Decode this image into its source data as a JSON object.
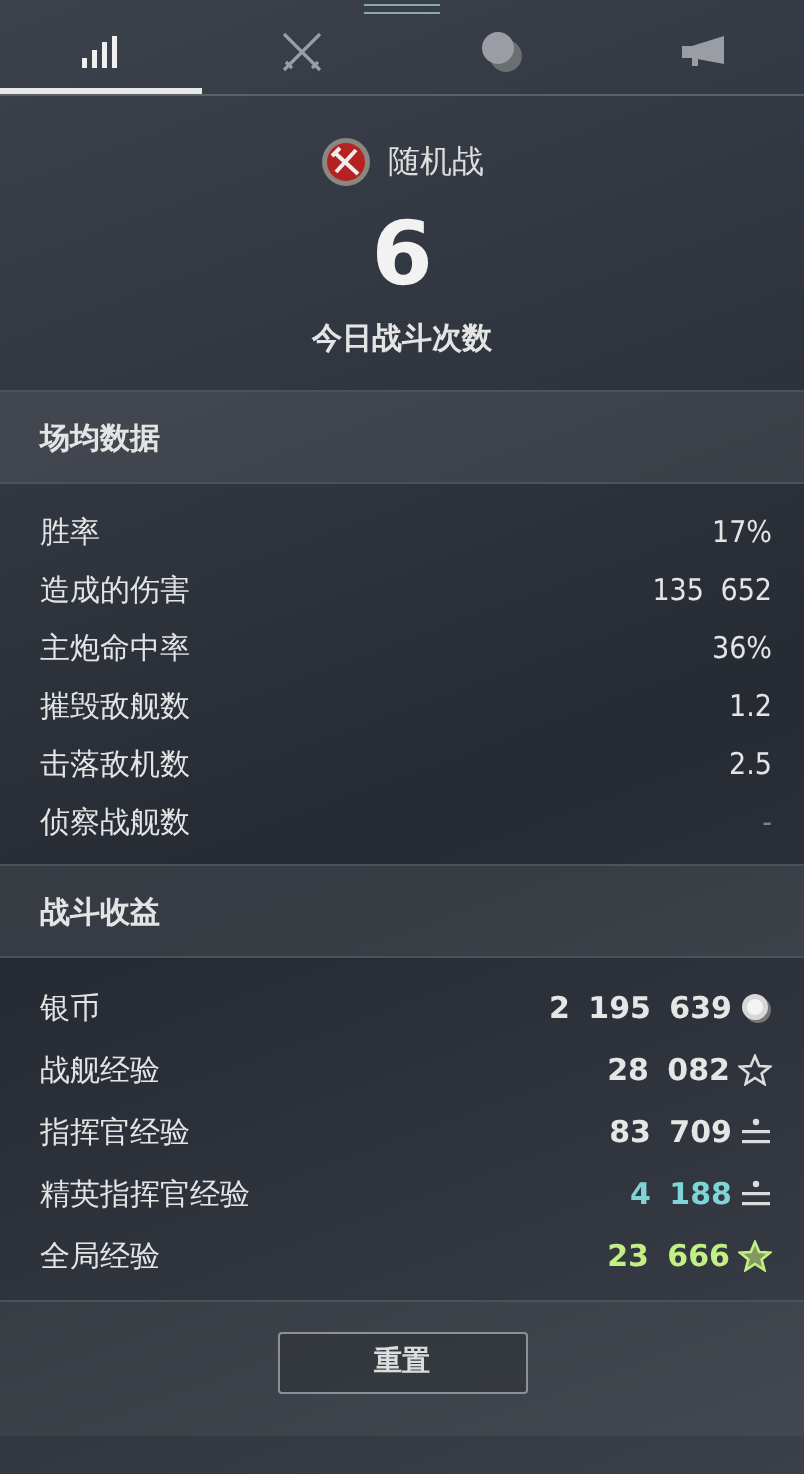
{
  "tabs": [
    {
      "kind": "stats",
      "selected": true
    },
    {
      "kind": "swords",
      "selected": false
    },
    {
      "kind": "coins",
      "selected": false
    },
    {
      "kind": "horn",
      "selected": false
    }
  ],
  "battle": {
    "mode": "随机战",
    "count": "6",
    "count_label": "今日战斗次数"
  },
  "averages": {
    "title": "场均数据",
    "rows": [
      {
        "label": "胜率",
        "value": "17%",
        "muted": false
      },
      {
        "label": "造成的伤害",
        "value": "135 652",
        "muted": false
      },
      {
        "label": "主炮命中率",
        "value": "36%",
        "muted": false
      },
      {
        "label": "摧毁敌舰数",
        "value": "1.2",
        "muted": false
      },
      {
        "label": "击落敌机数",
        "value": "2.5",
        "muted": false
      },
      {
        "label": "侦察战舰数",
        "value": "-",
        "muted": true
      }
    ]
  },
  "earnings": {
    "title": "战斗收益",
    "rows": [
      {
        "label": "银币",
        "value": "2 195 639",
        "kind": "coin",
        "color": "#e6e6e6"
      },
      {
        "label": "战舰经验",
        "value": "28 082",
        "kind": "star",
        "color": "#e6e6e6"
      },
      {
        "label": "指挥官经验",
        "value": "83 709",
        "kind": "commander",
        "color": "#e6e6e6"
      },
      {
        "label": "精英指挥官经验",
        "value": "4 188",
        "kind": "commander",
        "color": "#7fd4d8"
      },
      {
        "label": "全局经验",
        "value": "23 666",
        "kind": "free",
        "color": "#c3ef84"
      }
    ]
  },
  "reset_button": "重置"
}
